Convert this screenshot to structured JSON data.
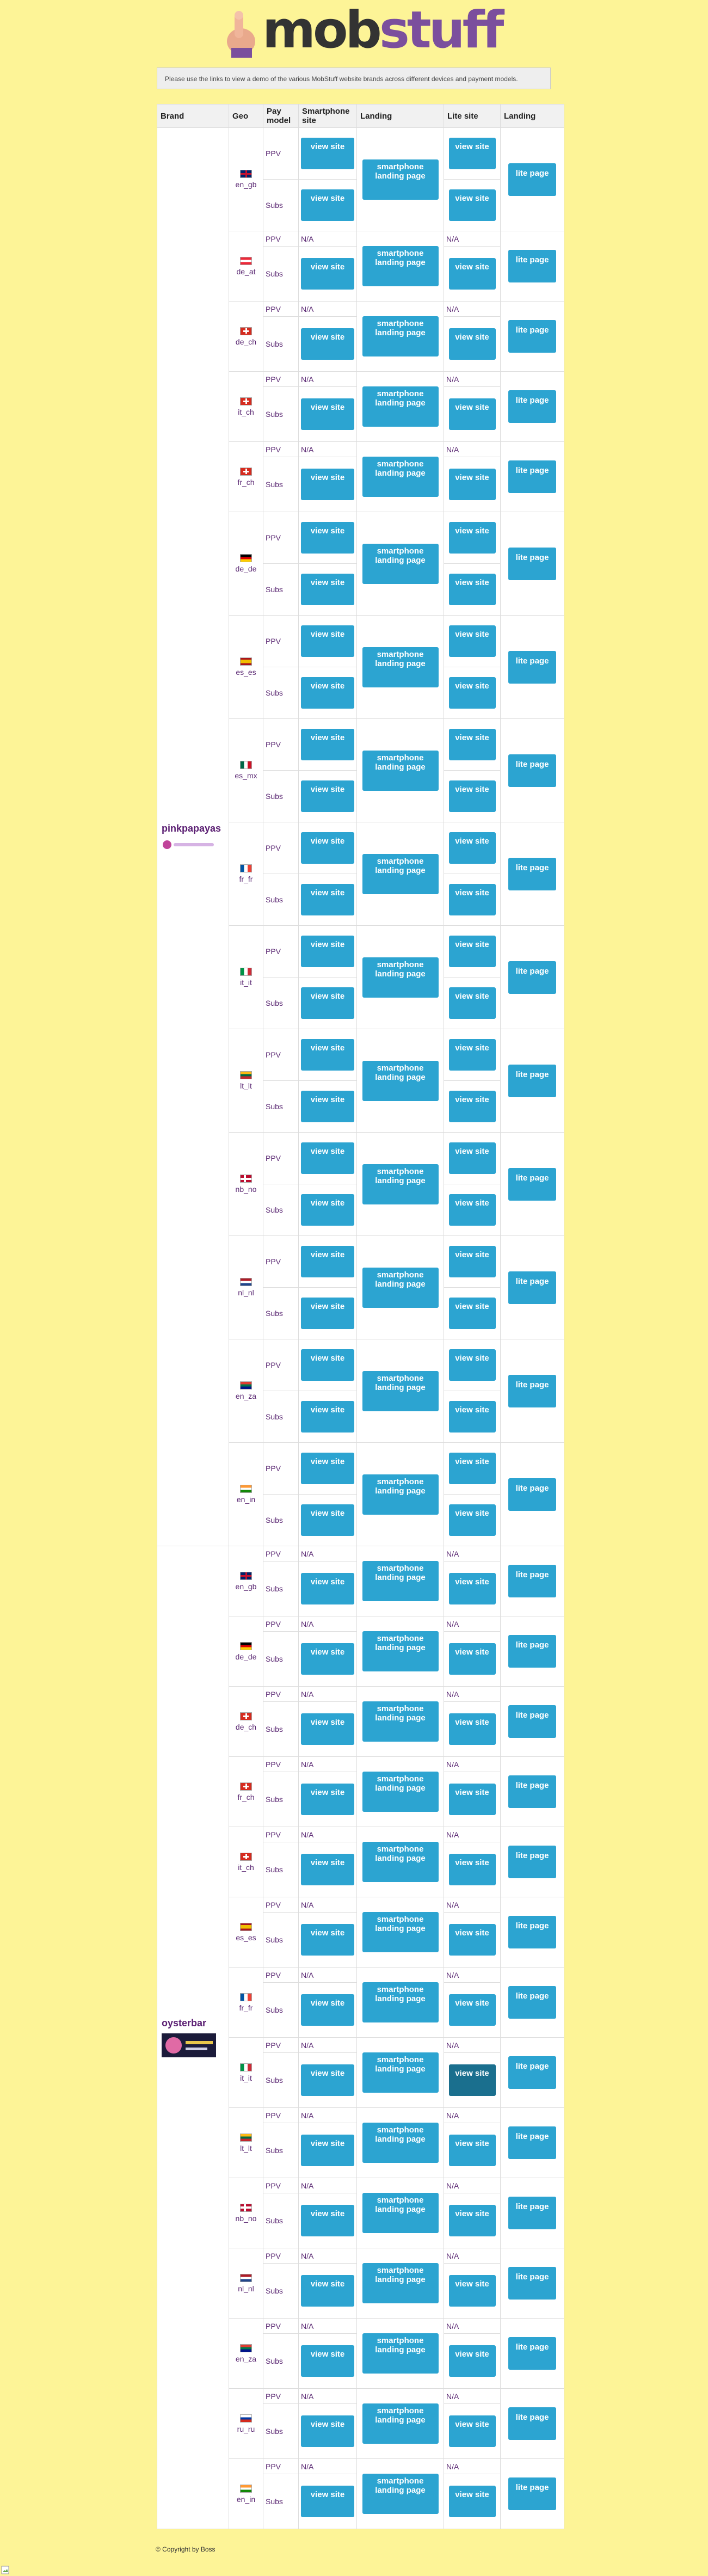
{
  "header": {
    "logo_text_1": "mob",
    "logo_text_2": "stuff",
    "notice": "Please use the links to view a demo of the various MobStuff website brands across different devices and payment models."
  },
  "columns": [
    "Brand",
    "Geo",
    "Pay model",
    "Smartphone site",
    "Landing",
    "Lite site",
    "Landing"
  ],
  "labels": {
    "ppv": "PPV",
    "subs": "Subs",
    "na": "N/A",
    "view_site": "view site",
    "smartphone_landing": "smartphone landing page",
    "lite_page": "lite page"
  },
  "brands": [
    {
      "name": "pinkpapayas",
      "logo": "pinkpapayas-logo",
      "geos": [
        {
          "code": "en_gb",
          "flag": "uk-flag",
          "ppv_smart": true,
          "ppv_lite": true,
          "h": 190
        },
        {
          "code": "de_at",
          "flag": "austria-flag",
          "ppv_smart": false,
          "ppv_lite": false,
          "h": 129
        },
        {
          "code": "de_ch",
          "flag": "swiss-flag",
          "ppv_smart": false,
          "ppv_lite": false,
          "h": 129
        },
        {
          "code": "it_ch",
          "flag": "swiss-flag",
          "ppv_smart": false,
          "ppv_lite": false,
          "h": 129
        },
        {
          "code": "fr_ch",
          "flag": "swiss-flag",
          "ppv_smart": false,
          "ppv_lite": false,
          "h": 129
        },
        {
          "code": "de_de",
          "flag": "germany-flag",
          "ppv_smart": true,
          "ppv_lite": true,
          "h": 190
        },
        {
          "code": "es_es",
          "flag": "spain-flag",
          "ppv_smart": true,
          "ppv_lite": true,
          "h": 190
        },
        {
          "code": "es_mx",
          "flag": "mexico-flag",
          "ppv_smart": true,
          "ppv_lite": true,
          "h": 190
        },
        {
          "code": "fr_fr",
          "flag": "france-flag",
          "ppv_smart": true,
          "ppv_lite": true,
          "h": 190
        },
        {
          "code": "it_it",
          "flag": "italy-flag",
          "ppv_smart": true,
          "ppv_lite": true,
          "h": 190
        },
        {
          "code": "lt_lt",
          "flag": "lithuania-flag",
          "ppv_smart": true,
          "ppv_lite": true,
          "h": 190
        },
        {
          "code": "nb_no",
          "flag": "norway-flag",
          "ppv_smart": true,
          "ppv_lite": true,
          "h": 190
        },
        {
          "code": "nl_nl",
          "flag": "netherlands-flag",
          "ppv_smart": true,
          "ppv_lite": true,
          "h": 190
        },
        {
          "code": "en_za",
          "flag": "south-africa-flag",
          "ppv_smart": true,
          "ppv_lite": true,
          "h": 190
        },
        {
          "code": "en_in",
          "flag": "india-flag",
          "ppv_smart": true,
          "ppv_lite": true,
          "h": 190
        }
      ]
    },
    {
      "name": "oysterbar",
      "logo": "oysterbar-logo",
      "geos": [
        {
          "code": "en_gb",
          "flag": "uk-flag",
          "ppv_smart": false,
          "ppv_lite": false,
          "h": 129
        },
        {
          "code": "de_de",
          "flag": "germany-flag",
          "ppv_smart": false,
          "ppv_lite": false,
          "h": 129
        },
        {
          "code": "de_ch",
          "flag": "swiss-flag",
          "ppv_smart": false,
          "ppv_lite": false,
          "h": 129
        },
        {
          "code": "fr_ch",
          "flag": "swiss-flag",
          "ppv_smart": false,
          "ppv_lite": false,
          "h": 129
        },
        {
          "code": "it_ch",
          "flag": "swiss-flag",
          "ppv_smart": false,
          "ppv_lite": false,
          "h": 129
        },
        {
          "code": "es_es",
          "flag": "spain-flag",
          "ppv_smart": false,
          "ppv_lite": false,
          "h": 129
        },
        {
          "code": "fr_fr",
          "flag": "france-flag",
          "ppv_smart": false,
          "ppv_lite": false,
          "h": 129
        },
        {
          "code": "it_it",
          "flag": "italy-flag",
          "ppv_smart": false,
          "ppv_lite": false,
          "h": 129,
          "lite_subs_active": true
        },
        {
          "code": "lt_lt",
          "flag": "lithuania-flag",
          "ppv_smart": false,
          "ppv_lite": false,
          "h": 129
        },
        {
          "code": "nb_no",
          "flag": "norway-flag",
          "ppv_smart": false,
          "ppv_lite": false,
          "h": 129
        },
        {
          "code": "nl_nl",
          "flag": "netherlands-flag",
          "ppv_smart": false,
          "ppv_lite": false,
          "h": 129
        },
        {
          "code": "en_za",
          "flag": "south-africa-flag",
          "ppv_smart": false,
          "ppv_lite": false,
          "h": 129
        },
        {
          "code": "ru_ru",
          "flag": "russia-flag",
          "ppv_smart": false,
          "ppv_lite": false,
          "h": 129
        },
        {
          "code": "en_in",
          "flag": "india-flag",
          "ppv_smart": false,
          "ppv_lite": false,
          "h": 129
        }
      ]
    }
  ],
  "footer": "© Copyright by Boss"
}
